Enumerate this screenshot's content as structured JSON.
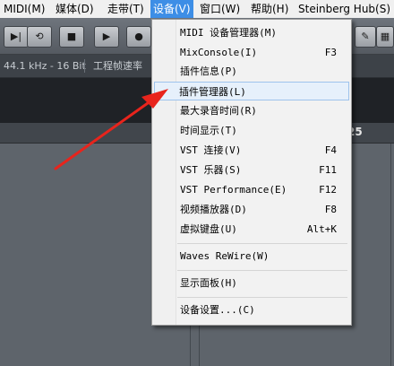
{
  "menubar": {
    "items": [
      {
        "label": "MIDI(M)"
      },
      {
        "label": "媒体(D)"
      },
      {
        "label": "走带(T)"
      },
      {
        "label": "设备(V)"
      },
      {
        "label": "窗口(W)"
      },
      {
        "label": "帮助(H)"
      },
      {
        "label": "Steinberg Hub(S)"
      }
    ]
  },
  "infobar": {
    "format": "44.1 kHz - 16 Bit",
    "frame_rate": "工程帧速率"
  },
  "ruler": {
    "bar_number": "25"
  },
  "devices_menu": {
    "items": [
      {
        "label": "MIDI 设备管理器(M)",
        "shortcut": ""
      },
      {
        "label": "MixConsole(I)",
        "shortcut": "F3"
      },
      {
        "label": "插件信息(P)",
        "shortcut": ""
      },
      {
        "label": "插件管理器(L)",
        "shortcut": ""
      },
      {
        "label": "最大录音时间(R)",
        "shortcut": ""
      },
      {
        "label": "时间显示(T)",
        "shortcut": ""
      },
      {
        "label": "VST 连接(V)",
        "shortcut": "F4"
      },
      {
        "label": "VST 乐器(S)",
        "shortcut": "F11"
      },
      {
        "label": "VST Performance(E)",
        "shortcut": "F12"
      },
      {
        "label": "视频播放器(D)",
        "shortcut": "F8"
      },
      {
        "label": "虚拟键盘(U)",
        "shortcut": "Alt+K"
      },
      {
        "label": "Waves ReWire(W)",
        "shortcut": ""
      },
      {
        "label": "显示面板(H)",
        "shortcut": ""
      },
      {
        "label": "设备设置...(C)",
        "shortcut": ""
      }
    ],
    "highlighted_index": 3
  },
  "colors": {
    "menu_highlight": "#3d8ee6",
    "arrow": "#e8241c"
  }
}
